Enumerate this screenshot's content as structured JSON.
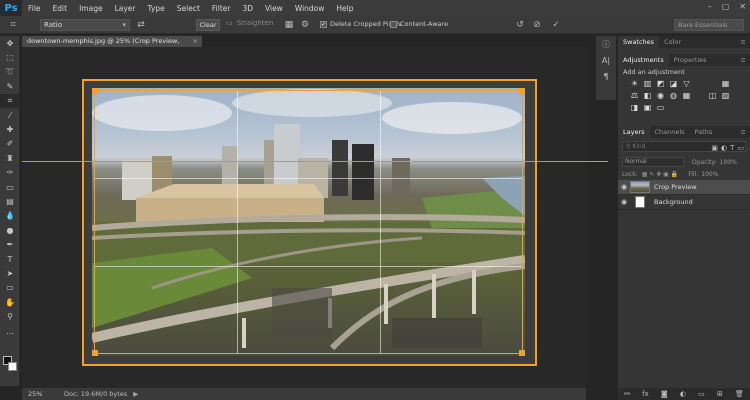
{
  "app": {
    "logo": "Ps"
  },
  "menu": [
    "File",
    "Edit",
    "Image",
    "Layer",
    "Type",
    "Select",
    "Filter",
    "3D",
    "View",
    "Window",
    "Help"
  ],
  "window_controls": [
    "–",
    "▢",
    "✕"
  ],
  "options": {
    "ratio": "Ratio",
    "clear_label": "Clear",
    "straighten_label": "Straighten",
    "delete_cropped_label": "Delete Cropped Pixels",
    "delete_cropped_checked": true,
    "content_aware_label": "Content-Aware",
    "content_aware_checked": false,
    "workspace": "Bare Essentials"
  },
  "document": {
    "tab_title": "downtown-memphis.jpg @ 25% (Crop Preview, RGB/8#) *",
    "close": "×"
  },
  "status": {
    "zoom": "25%",
    "doc_info": "Doc: 19.6M/0 bytes",
    "arrow": "▶"
  },
  "panels": {
    "top_tabs": [
      "Swatches",
      "Color"
    ],
    "adj_tabs": [
      "Adjustments",
      "Properties"
    ],
    "adj_title": "Add an adjustment",
    "layer_tabs": [
      "Layers",
      "Channels",
      "Paths"
    ],
    "search_placeholder": "Kind",
    "blend_mode": "Normal",
    "opacity_label": "Opacity:",
    "opacity_value": "100%",
    "lock_label": "Lock:",
    "fill_label": "Fill:",
    "fill_value": "100%",
    "layers": [
      {
        "name": "Crop Preview",
        "selected": true
      },
      {
        "name": "Background",
        "selected": false
      }
    ]
  },
  "colors": {
    "crop_accent": "#f4a124",
    "guide": "#1fd1d8"
  }
}
